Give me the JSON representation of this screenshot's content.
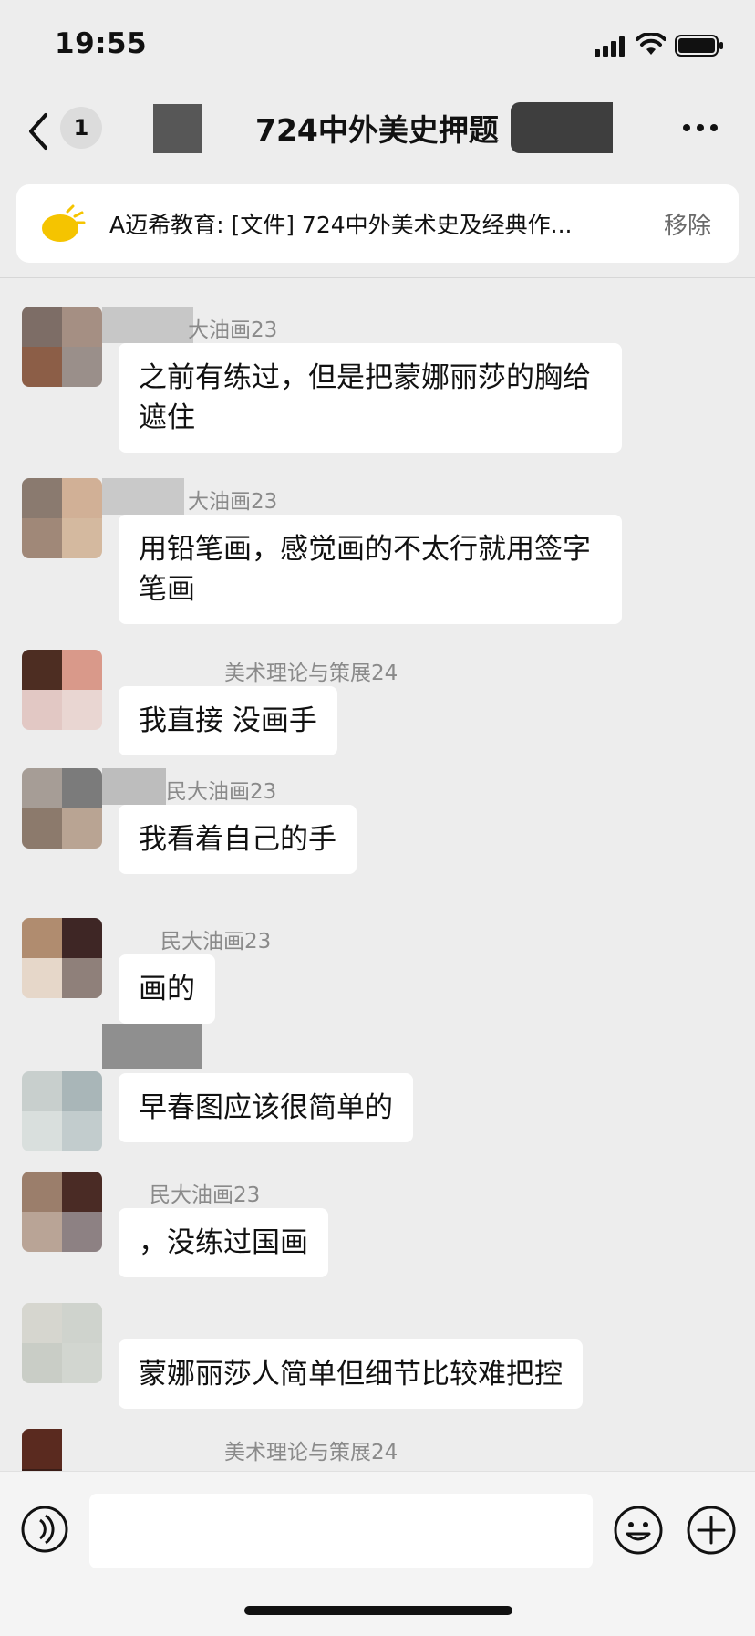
{
  "status_bar": {
    "time": "19:55"
  },
  "header": {
    "unread_count": "1",
    "title": "724中外美史押题"
  },
  "pinned": {
    "text": "A迈希教育: [文件] 724中外美术史及经典作...",
    "remove_label": "移除"
  },
  "messages": [
    {
      "sender": "大油画23",
      "text": "之前有练过，但是把蒙娜丽莎的胸给遮住"
    },
    {
      "sender": "大油画23",
      "text": "用铅笔画，感觉画的不太行就用签字笔画"
    },
    {
      "sender": "美术理论与策展24",
      "text": "我直接 没画手"
    },
    {
      "sender": "民大油画23",
      "text": "我看着自己的手"
    },
    {
      "sender": "民大油画23",
      "text": "画的"
    },
    {
      "sender": "",
      "text": "早春图应该很简单的"
    },
    {
      "sender": "民大油画23",
      "text": "，没练过国画"
    },
    {
      "sender": "",
      "text": "蒙娜丽莎人简单但细节比较难把控"
    },
    {
      "sender": "美术理论与策展24",
      "text": ""
    }
  ],
  "input": {
    "value": "",
    "placeholder": ""
  }
}
